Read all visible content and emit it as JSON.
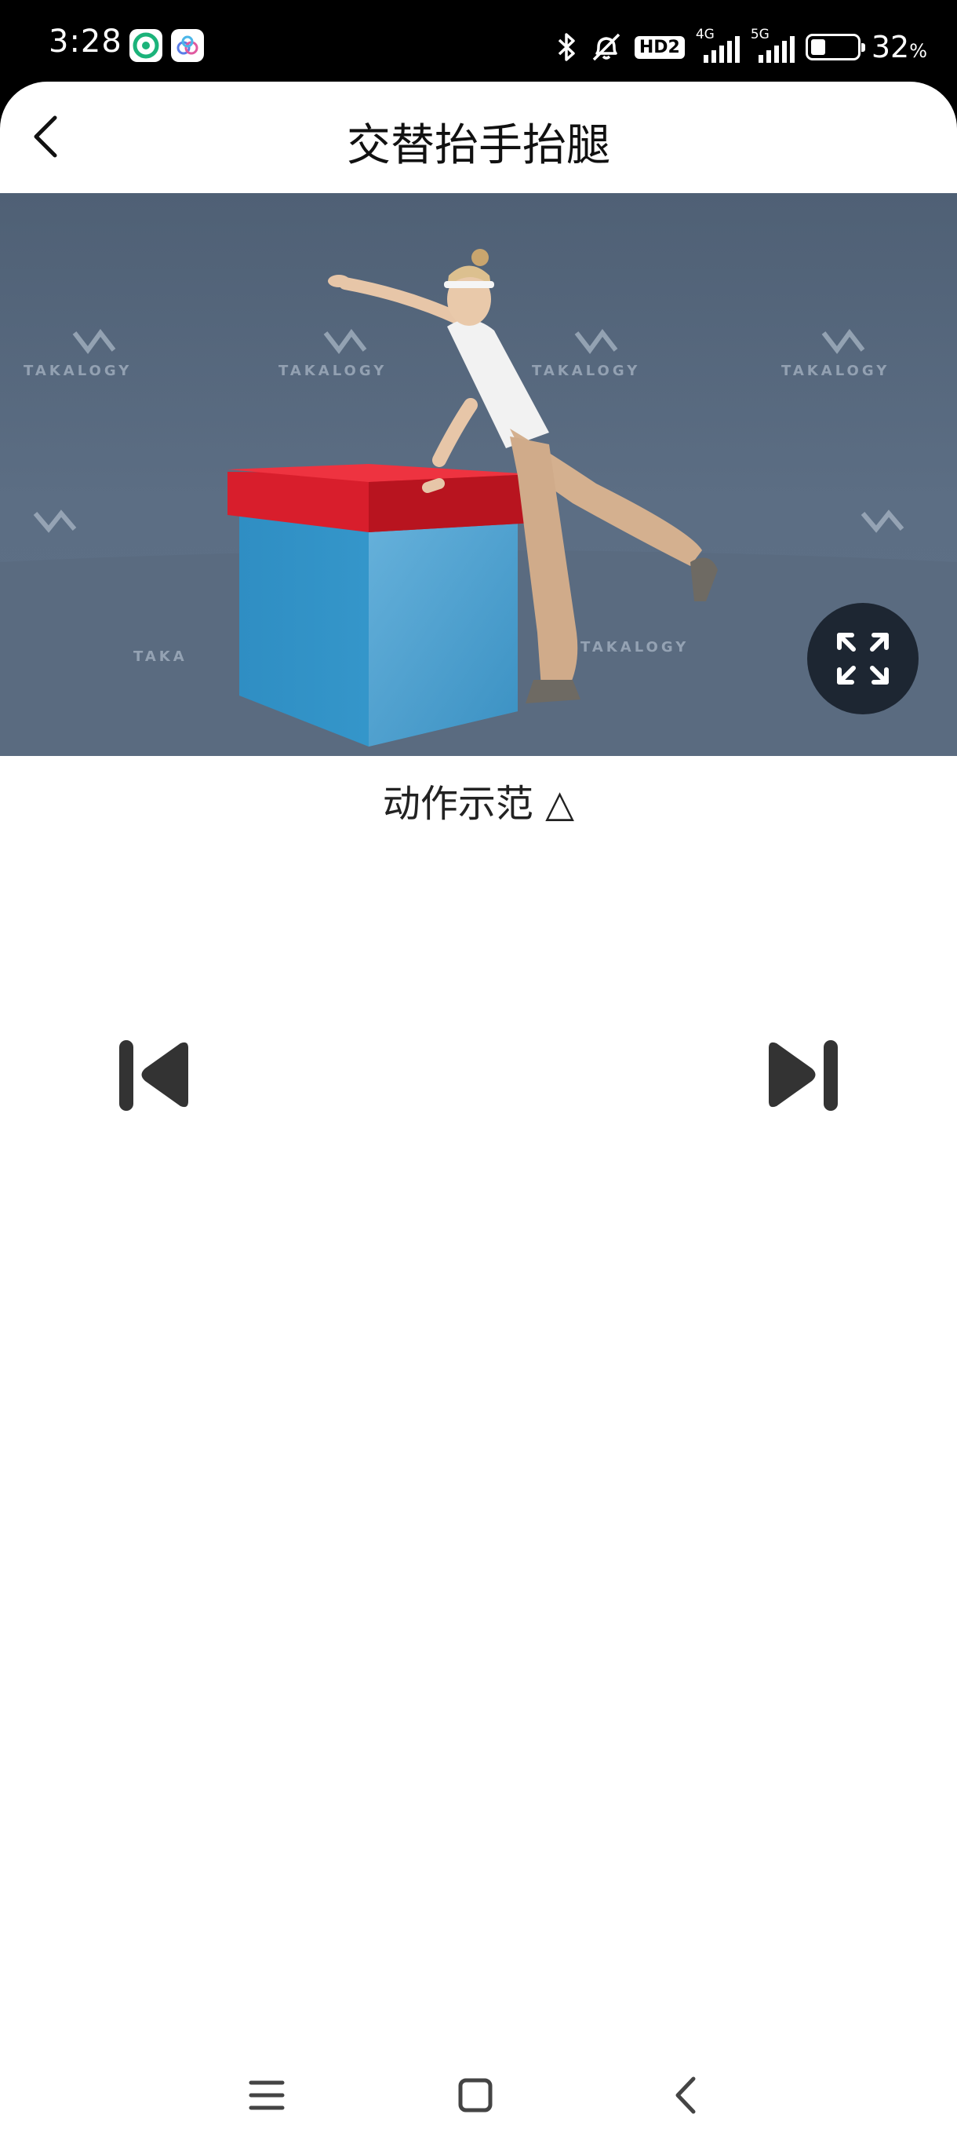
{
  "status_bar": {
    "time": "3:28",
    "network_4g": "4G",
    "network_5g": "5G",
    "hd_badge": "HD2",
    "battery_percent": "32",
    "battery_unit": "%",
    "battery_level": 0.32,
    "icons": [
      "cleaner-app-icon",
      "cloud-app-icon",
      "bluetooth-icon",
      "silent-bell-icon",
      "signal-icon",
      "battery-icon"
    ]
  },
  "header": {
    "title": "交替抬手抬腿",
    "back_icon": "chevron-left-icon"
  },
  "video": {
    "watermark": "TAKALOGY",
    "fullscreen_icon": "expand-icon"
  },
  "caption": "动作示范 △",
  "controls": {
    "prev_icon": "skip-previous-icon",
    "next_icon": "skip-next-icon"
  },
  "system_nav": {
    "icons": [
      "menu-icon",
      "home-icon",
      "back-icon"
    ]
  }
}
